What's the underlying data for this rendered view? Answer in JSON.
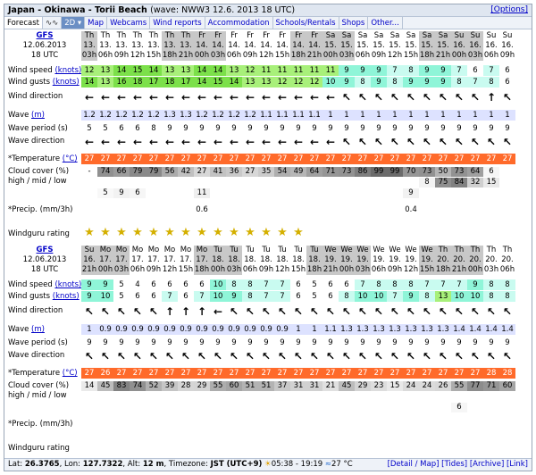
{
  "title": {
    "location": "Japan - Okinawa - Torii Beach",
    "wave": "(wave: NWW3 12.6. 2013 18 UTC)",
    "options": "[Options]"
  },
  "tabs": [
    {
      "label": "Forecast",
      "cls": "active"
    },
    {
      "label": "∿∿",
      "cls": "ico"
    },
    {
      "label": "2D ▾",
      "cls": "dd"
    },
    {
      "label": "Map",
      "cls": ""
    },
    {
      "label": "Webcams",
      "cls": ""
    },
    {
      "label": "Wind reports",
      "cls": ""
    },
    {
      "label": "Accommodation",
      "cls": ""
    },
    {
      "label": "Schools/Rentals",
      "cls": ""
    },
    {
      "label": "Shops",
      "cls": ""
    },
    {
      "label": "Other...",
      "cls": ""
    }
  ],
  "labels": {
    "wind_speed": "Wind speed",
    "wind_gusts": "Wind gusts",
    "knots": "(knots)",
    "wind_direction": "Wind direction",
    "wave": "Wave",
    "m": "(m)",
    "wave_period": "Wave period (s)",
    "wave_direction": "Wave direction",
    "temperature": "*Temperature",
    "celsius": "(°C)",
    "cloud": "Cloud cover (%)",
    "cloud2": "high / mid / low",
    "precip": "*Precip. (mm/3h)",
    "rating": "Windguru rating"
  },
  "sections": [
    {
      "model": "GFS",
      "date": "12.06.2013",
      "utc": "18 UTC",
      "days": [
        "Th",
        "Th",
        "Th",
        "Th",
        "Th",
        "Th",
        "Th",
        "Fr",
        "Fr",
        "Fr",
        "Fr",
        "Fr",
        "Fr",
        "Fr",
        "Fr",
        "Sa",
        "Sa",
        "Sa",
        "Sa",
        "Sa",
        "Sa",
        "Sa",
        "Sa",
        "Su",
        "Su",
        "Su",
        "Su"
      ],
      "dates": [
        "13.",
        "13.",
        "13.",
        "13.",
        "13.",
        "13.",
        "13.",
        "14.",
        "14.",
        "14.",
        "14.",
        "14.",
        "14.",
        "14.",
        "14.",
        "15.",
        "15.",
        "15.",
        "15.",
        "15.",
        "15.",
        "15.",
        "15.",
        "16.",
        "16.",
        "16.",
        "16."
      ],
      "hours": [
        "03h",
        "06h",
        "09h",
        "12h",
        "15h",
        "18h",
        "21h",
        "00h",
        "03h",
        "06h",
        "09h",
        "12h",
        "15h",
        "18h",
        "21h",
        "00h",
        "03h",
        "06h",
        "09h",
        "12h",
        "15h",
        "18h",
        "21h",
        "00h",
        "03h",
        "06h",
        "09h"
      ],
      "night": [
        1,
        0,
        0,
        0,
        0,
        1,
        1,
        1,
        1,
        0,
        0,
        0,
        0,
        1,
        1,
        1,
        1,
        0,
        0,
        0,
        0,
        1,
        1,
        1,
        1,
        0,
        0
      ],
      "wind_speed": [
        "12",
        "13",
        "14",
        "15",
        "14",
        "13",
        "13",
        "14",
        "14",
        "13",
        "12",
        "11",
        "11",
        "11",
        "11",
        "11",
        "9",
        "9",
        "9",
        "7",
        "8",
        "9",
        "9",
        "7",
        "6",
        "7",
        "6"
      ],
      "wind_gusts": [
        "14",
        "13",
        "16",
        "18",
        "17",
        "18",
        "17",
        "14",
        "15",
        "14",
        "13",
        "13",
        "12",
        "12",
        "12",
        "10",
        "9",
        "8",
        "9",
        "8",
        "9",
        "9",
        "9",
        "8",
        "7",
        "8",
        "6"
      ],
      "wind_dir": [
        "←",
        "←",
        "←",
        "←",
        "←",
        "←",
        "←",
        "←",
        "←",
        "←",
        "←",
        "←",
        "←",
        "←",
        "←",
        "←",
        "↖",
        "↖",
        "↖",
        "↖",
        "↖",
        "↖",
        "↖",
        "↖",
        "↖",
        "↑",
        "↖"
      ],
      "wave": [
        "1.2",
        "1.2",
        "1.2",
        "1.2",
        "1.2",
        "1.3",
        "1.3",
        "1.2",
        "1.2",
        "1.2",
        "1.2",
        "1.1",
        "1.1",
        "1.1",
        "1.1",
        "1",
        "1",
        "1",
        "1",
        "1",
        "1",
        "1",
        "1",
        "1",
        "1",
        "1",
        "1"
      ],
      "wave_period": [
        "5",
        "5",
        "6",
        "6",
        "8",
        "9",
        "9",
        "9",
        "9",
        "9",
        "9",
        "9",
        "9",
        "9",
        "9",
        "9",
        "9",
        "9",
        "9",
        "9",
        "9",
        "9",
        "9",
        "9",
        "9",
        "9",
        "9"
      ],
      "wave_dir": [
        "←",
        "←",
        "←",
        "←",
        "←",
        "←",
        "←",
        "←",
        "←",
        "←",
        "←",
        "←",
        "←",
        "←",
        "←",
        "←",
        "↖",
        "↖",
        "↖",
        "↖",
        "↖",
        "↖",
        "↖",
        "↖",
        "↖",
        "↖",
        "↖"
      ],
      "temperature": [
        "27",
        "27",
        "27",
        "27",
        "27",
        "27",
        "27",
        "27",
        "27",
        "27",
        "27",
        "27",
        "27",
        "27",
        "27",
        "27",
        "27",
        "27",
        "27",
        "27",
        "27",
        "27",
        "27",
        "27",
        "27",
        "27",
        "27"
      ],
      "cloud_high": [
        "-",
        "74",
        "66",
        "79",
        "79",
        "56",
        "42",
        "27",
        "41",
        "36",
        "27",
        "35",
        "54",
        "49",
        "64",
        "71",
        "73",
        "86",
        "99",
        "99",
        "70",
        "73",
        "50",
        "73",
        "64",
        "6",
        ""
      ],
      "cloud_mid": [
        "",
        "",
        "",
        "",
        "",
        "",
        "",
        "",
        "",
        "",
        "",
        "",
        "",
        "",
        "",
        "",
        "",
        "",
        "",
        "",
        "",
        "8",
        "75",
        "84",
        "32",
        "15",
        ""
      ],
      "cloud_low": [
        "",
        "5",
        "9",
        "6",
        "",
        "",
        "",
        "11",
        "",
        "",
        "",
        "",
        "",
        "",
        "",
        "",
        "",
        "",
        "",
        "",
        "9",
        "",
        "",
        "",
        "",
        "",
        ""
      ],
      "precip": [
        "",
        "",
        "",
        "",
        "",
        "",
        "",
        "0.6",
        "",
        "",
        "",
        "",
        "",
        "",
        "",
        "",
        "",
        "",
        "",
        "",
        "0.4",
        "",
        "",
        "",
        "",
        "",
        ""
      ],
      "rating": 14
    },
    {
      "model": "GFS",
      "date": "12.06.2013",
      "utc": "18 UTC",
      "days": [
        "Su",
        "Mo",
        "Mo",
        "Mo",
        "Mo",
        "Mo",
        "Mo",
        "Mo",
        "Tu",
        "Tu",
        "Tu",
        "Tu",
        "Tu",
        "Tu",
        "Tu",
        "We",
        "We",
        "We",
        "We",
        "We",
        "We",
        "We",
        "Th",
        "Th",
        "Th",
        "Th",
        "Th"
      ],
      "dates": [
        "16.",
        "17.",
        "17.",
        "17.",
        "17.",
        "17.",
        "17.",
        "17.",
        "18.",
        "18.",
        "18.",
        "18.",
        "18.",
        "18.",
        "18.",
        "19.",
        "19.",
        "19.",
        "19.",
        "19.",
        "19.",
        "19.",
        "20.",
        "20.",
        "20.",
        "20.",
        "20."
      ],
      "hours": [
        "21h",
        "00h",
        "03h",
        "06h",
        "09h",
        "12h",
        "15h",
        "18h",
        "00h",
        "03h",
        "06h",
        "09h",
        "12h",
        "15h",
        "18h",
        "21h",
        "00h",
        "03h",
        "06h",
        "09h",
        "12h",
        "15h",
        "18h",
        "21h",
        "00h",
        "03h",
        "06h"
      ],
      "night": [
        1,
        1,
        1,
        0,
        0,
        0,
        0,
        1,
        1,
        1,
        0,
        0,
        0,
        0,
        1,
        1,
        1,
        1,
        0,
        0,
        0,
        1,
        1,
        1,
        1,
        0,
        0
      ],
      "wind_speed": [
        "9",
        "9",
        "5",
        "4",
        "6",
        "6",
        "6",
        "6",
        "10",
        "8",
        "8",
        "7",
        "7",
        "6",
        "5",
        "6",
        "6",
        "7",
        "8",
        "8",
        "8",
        "7",
        "7",
        "7",
        "9",
        "8",
        "8"
      ],
      "wind_gusts": [
        "9",
        "10",
        "5",
        "6",
        "6",
        "7",
        "6",
        "7",
        "10",
        "9",
        "8",
        "7",
        "7",
        "6",
        "5",
        "6",
        "8",
        "10",
        "10",
        "7",
        "9",
        "8",
        "13",
        "10",
        "10",
        "8",
        "8"
      ],
      "wind_dir": [
        "↖",
        "↖",
        "↖",
        "↖",
        "↖",
        "↑",
        "↑",
        "↑",
        "←",
        "↖",
        "↖",
        "↖",
        "↖",
        "↖",
        "↖",
        "↖",
        "↖",
        "↖",
        "↖",
        "↖",
        "↖",
        "↖",
        "↖",
        "↖",
        "↖",
        "↖",
        "↖"
      ],
      "wave": [
        "1",
        "0.9",
        "0.9",
        "0.9",
        "0.9",
        "0.9",
        "0.9",
        "0.9",
        "0.9",
        "0.9",
        "0.9",
        "0.9",
        "0.9",
        "1",
        "1",
        "1.1",
        "1.3",
        "1.3",
        "1.3",
        "1.3",
        "1.3",
        "1.3",
        "1.3",
        "1.4",
        "1.4",
        "1.4",
        "1.4"
      ],
      "wave_period": [
        "9",
        "9",
        "9",
        "9",
        "9",
        "9",
        "9",
        "9",
        "9",
        "9",
        "9",
        "9",
        "9",
        "9",
        "9",
        "9",
        "9",
        "9",
        "9",
        "9",
        "9",
        "9",
        "9",
        "9",
        "9",
        "9",
        "9"
      ],
      "wave_dir": [
        "↖",
        "↖",
        "↖",
        "↖",
        "↖",
        "↖",
        "↖",
        "↖",
        "↖",
        "↖",
        "↖",
        "↖",
        "↖",
        "↖",
        "↖",
        "↖",
        "↖",
        "↖",
        "↖",
        "↖",
        "↖",
        "↖",
        "↖",
        "↖",
        "↖",
        "↖",
        "↖"
      ],
      "temperature": [
        "27",
        "26",
        "27",
        "27",
        "27",
        "27",
        "27",
        "27",
        "27",
        "27",
        "27",
        "27",
        "27",
        "27",
        "27",
        "27",
        "27",
        "27",
        "27",
        "27",
        "27",
        "27",
        "27",
        "27",
        "27",
        "28",
        "28"
      ],
      "cloud_high": [
        "14",
        "45",
        "83",
        "74",
        "52",
        "39",
        "28",
        "29",
        "55",
        "60",
        "51",
        "51",
        "37",
        "31",
        "31",
        "21",
        "45",
        "29",
        "23",
        "15",
        "24",
        "24",
        "26",
        "55",
        "77",
        "71",
        "60"
      ],
      "cloud_mid": [
        "",
        "",
        "",
        "",
        "",
        "",
        "",
        "",
        "",
        "",
        "",
        "",
        "",
        "",
        "",
        "",
        "",
        "",
        "",
        "",
        "",
        "",
        "",
        "",
        "",
        "",
        ""
      ],
      "cloud_low": [
        "",
        "",
        "",
        "",
        "",
        "",
        "",
        "",
        "",
        "",
        "",
        "",
        "",
        "",
        "",
        "",
        "",
        "",
        "",
        "",
        "",
        "",
        "",
        "6",
        "",
        "",
        ""
      ],
      "precip": [
        "",
        "",
        "",
        "",
        "",
        "",
        "",
        "",
        "",
        "",
        "",
        "",
        "",
        "",
        "",
        "",
        "",
        "",
        "",
        "",
        "",
        "",
        "",
        "",
        "",
        "",
        ""
      ],
      "rating": 0
    }
  ],
  "footer": {
    "lat_label": "Lat:",
    "lat": "26.3765",
    "lon_label": "Lon:",
    "lon": "127.7322",
    "alt_label": "Alt:",
    "alt": "12 m",
    "tz_label": "Timezone:",
    "tz": "JST (UTC+9)",
    "sun": "05:38 - 19:19",
    "temp": "27 °C",
    "links": "[Detail / Map] [Tides] [Archive] [Link]"
  },
  "colors": {
    "green_high": "#7ce04a",
    "green": "#a8f07a",
    "cyan": "#8ff5d8",
    "cyan_light": "#c9fbf0",
    "temp": "#ff6a2a",
    "night": "#c8c8c8"
  }
}
